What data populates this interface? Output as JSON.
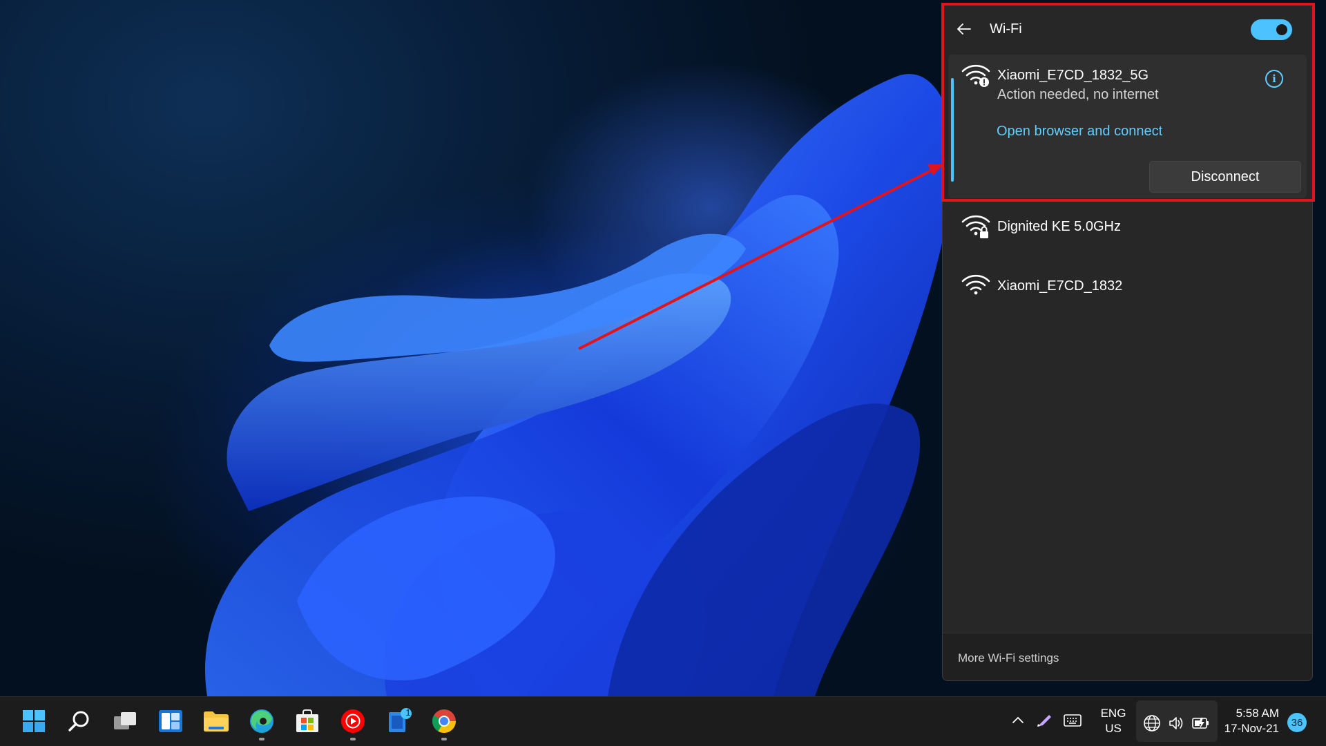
{
  "wifi_panel": {
    "title": "Wi-Fi",
    "toggle_state": "on",
    "active_network": {
      "name": "Xiaomi_E7CD_1832_5G",
      "status": "Action needed, no internet",
      "link": "Open browser and connect",
      "disconnect_label": "Disconnect",
      "icon": "wifi-warning-icon"
    },
    "networks": [
      {
        "name": "Dignited KE 5.0GHz",
        "icon": "wifi-secured-icon"
      },
      {
        "name": "Xiaomi_E7CD_1832",
        "icon": "wifi-icon"
      }
    ],
    "footer_link": "More Wi-Fi settings"
  },
  "taskbar": {
    "apps": [
      {
        "name": "start",
        "icon": "windows-logo-icon"
      },
      {
        "name": "search",
        "icon": "search-icon"
      },
      {
        "name": "task-view",
        "icon": "task-view-icon"
      },
      {
        "name": "widgets",
        "icon": "widgets-icon"
      },
      {
        "name": "file-explorer",
        "icon": "folder-icon"
      },
      {
        "name": "edge",
        "icon": "edge-icon"
      },
      {
        "name": "store",
        "icon": "store-icon"
      },
      {
        "name": "youtube-music",
        "icon": "youtube-music-icon"
      },
      {
        "name": "word",
        "icon": "word-icon",
        "badge": "1"
      },
      {
        "name": "chrome",
        "icon": "chrome-icon"
      }
    ],
    "language": {
      "line1": "ENG",
      "line2": "US"
    },
    "clock": {
      "time": "5:58 AM",
      "date": "17-Nov-21"
    },
    "notification_count": "36"
  },
  "colors": {
    "accent": "#4cc2ff",
    "link": "#60cdff",
    "annotation_red": "#e0141e",
    "panel_bg": "#272727"
  }
}
